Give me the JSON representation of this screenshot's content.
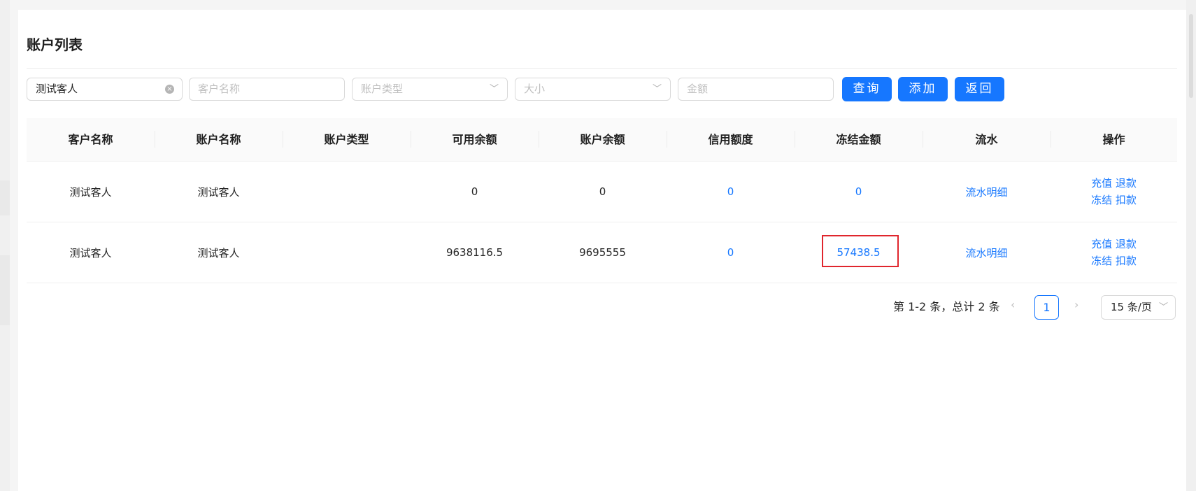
{
  "page_title": "账户列表",
  "filters": {
    "customer_value": "测试客人",
    "clear_icon": "×",
    "account_name_placeholder": "客户名称",
    "account_type_placeholder": "账户类型",
    "size_placeholder": "大小",
    "amount_placeholder": "金额",
    "chevron": "﹀"
  },
  "buttons": {
    "query": "查询",
    "add": "添加",
    "back": "返回"
  },
  "table": {
    "headers": [
      "客户名称",
      "账户名称",
      "账户类型",
      "可用余额",
      "账户余额",
      "信用额度",
      "冻结金额",
      "流水",
      "操作"
    ],
    "rows": [
      {
        "customer": "测试客人",
        "account": "测试客人",
        "type": "",
        "available": "0",
        "balance": "0",
        "credit": "0",
        "frozen": "0",
        "flow": "流水明细",
        "ops": {
          "recharge": "充值",
          "refund": "退款",
          "freeze": "冻结",
          "deduct": "扣款"
        }
      },
      {
        "customer": "测试客人",
        "account": "测试客人",
        "type": "",
        "available": "9638116.5",
        "balance": "9695555",
        "credit": "0",
        "frozen": "57438.5",
        "flow": "流水明细",
        "ops": {
          "recharge": "充值",
          "refund": "退款",
          "freeze": "冻结",
          "deduct": "扣款"
        }
      }
    ]
  },
  "pagination": {
    "summary": "第 1-2 条，总计 2 条",
    "prev": "‹",
    "next": "›",
    "current_page": "1",
    "page_size": "15 条/页"
  },
  "colors": {
    "primary": "#1677ff",
    "highlight": "#e0262d"
  }
}
